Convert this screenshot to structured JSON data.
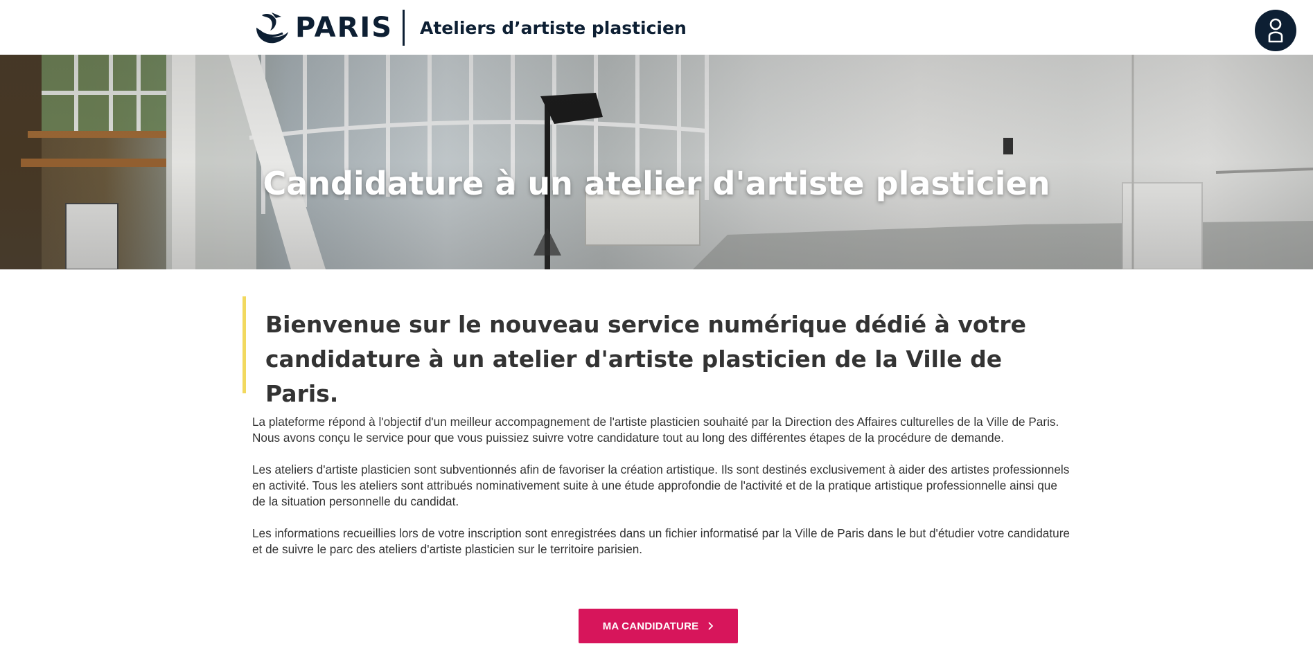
{
  "header": {
    "logo_text": "PARIS",
    "site_title": "Ateliers d’artiste plasticien",
    "logo_icon": "paris-boat-icon",
    "account_icon": "user-icon"
  },
  "hero": {
    "title": "Candidature à un atelier d'artiste plasticien"
  },
  "intro": {
    "title": "Bienvenue sur le nouveau service numérique dédié à votre candidature à un atelier d'artiste plasticien de la Ville de Paris."
  },
  "content": {
    "paragraphs": [
      "La plateforme répond à l'objectif d'un meilleur accompagnement de l'artiste plasticien souhaité par la Direction des Affaires culturelles de la Ville de Paris. Nous avons conçu le service pour que vous puissiez suivre votre candidature tout au long des différentes étapes de la procédure de demande.",
      "Les ateliers d'artiste plasticien sont subventionnés afin de favoriser la création artistique. Ils sont destinés exclusivement à aider des artistes professionnels en activité. Tous les ateliers sont attribués nominativement suite à une étude approfondie de l'activité et de la pratique artistique professionnelle ainsi que de la situation personnelle du candidat.",
      "Les informations recueillies lors de votre inscription sont enregistrées dans un fichier informatisé par la Ville de Paris dans le but d'étudier votre candidature et de suivre le parc des ateliers d'artiste plasticien sur le territoire parisien."
    ]
  },
  "cta": {
    "label": "MA CANDIDATURE",
    "icon": "chevron-right-icon"
  },
  "colors": {
    "navy": "#0d1f33",
    "accent_yellow": "#f2d95f",
    "cta_pink": "#d7155b"
  }
}
